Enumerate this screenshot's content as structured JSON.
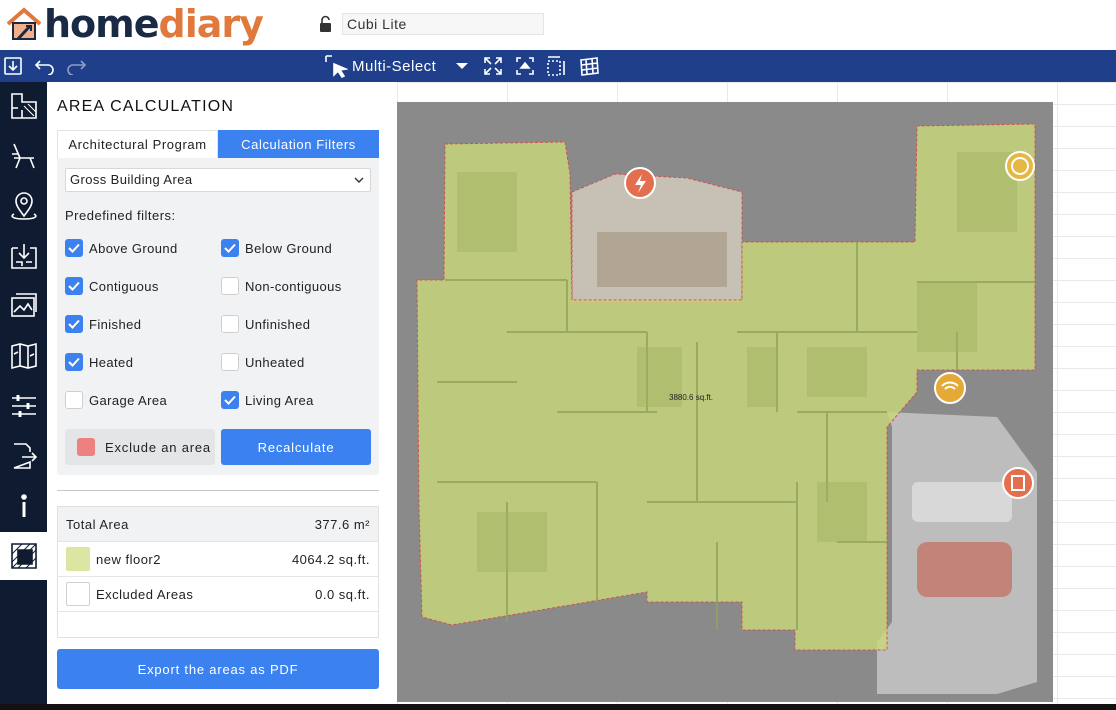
{
  "app": {
    "logo_home": "home",
    "logo_diary": "diary",
    "logo_icon": "house-logo-icon",
    "lock_icon": "unlock-icon",
    "project_name": "Cubi Lite"
  },
  "toolbar": {
    "save_icon": "download-icon",
    "undo_icon": "undo-icon",
    "redo_icon": "redo-icon",
    "multiselect_label": "Multi-Select",
    "multiselect_icon": "cursor-select-icon",
    "dropdown_icon": "caret-down-icon",
    "fit_icon": "expand-icon",
    "center_icon": "focus-icon",
    "measure_icon": "dimension-icon",
    "grid_icon": "grid-icon"
  },
  "sidebar": {
    "items": [
      {
        "name": "floorplan-icon"
      },
      {
        "name": "chair-icon"
      },
      {
        "name": "map-pin-icon"
      },
      {
        "name": "import-icon"
      },
      {
        "name": "gallery-icon"
      },
      {
        "name": "map-book-icon"
      },
      {
        "name": "sliders-icon"
      },
      {
        "name": "export-icon"
      },
      {
        "name": "info-icon"
      },
      {
        "name": "area-calculation-icon",
        "active": true
      }
    ]
  },
  "panel": {
    "title": "AREA CALCULATION",
    "tabs": [
      {
        "label": "Architectural Program",
        "active": false
      },
      {
        "label": "Calculation Filters",
        "active": true
      }
    ],
    "area_type": "Gross Building Area",
    "predefined_label": "Predefined filters:",
    "filters": [
      {
        "label": "Above Ground",
        "checked": true
      },
      {
        "label": "Below Ground",
        "checked": true
      },
      {
        "label": "Contiguous",
        "checked": true
      },
      {
        "label": "Non-contiguous",
        "checked": false
      },
      {
        "label": "Finished",
        "checked": true
      },
      {
        "label": "Unfinished",
        "checked": false
      },
      {
        "label": "Heated",
        "checked": true
      },
      {
        "label": "Unheated",
        "checked": false
      },
      {
        "label": "Garage Area",
        "checked": false
      },
      {
        "label": "Living Area",
        "checked": true
      }
    ],
    "exclude_label": "Exclude an area",
    "recalculate_label": "Recalculate",
    "results": {
      "total_label": "Total Area",
      "total_value": "377.6 m²",
      "rows": [
        {
          "label": "new floor2",
          "value": "4064.2 sq.ft.",
          "color": "#dce5a2"
        },
        {
          "label": "Excluded Areas",
          "value": "0.0 sq.ft.",
          "color": "#ffffff"
        }
      ]
    },
    "export_label": "Export the areas as PDF"
  },
  "canvas": {
    "area_label": "3880.6 sq.ft.",
    "markers": [
      "electric-icon",
      "hvac-icon",
      "wifi-icon",
      "appliance-icon"
    ]
  },
  "colors": {
    "header_blue": "#1f3f8a",
    "sidebar_navy": "#0f1b30",
    "accent_blue": "#3b82f0",
    "logo_orange": "#e07a3c",
    "area_fill": "#c8d87a",
    "exclude_swatch": "#ee8080"
  }
}
